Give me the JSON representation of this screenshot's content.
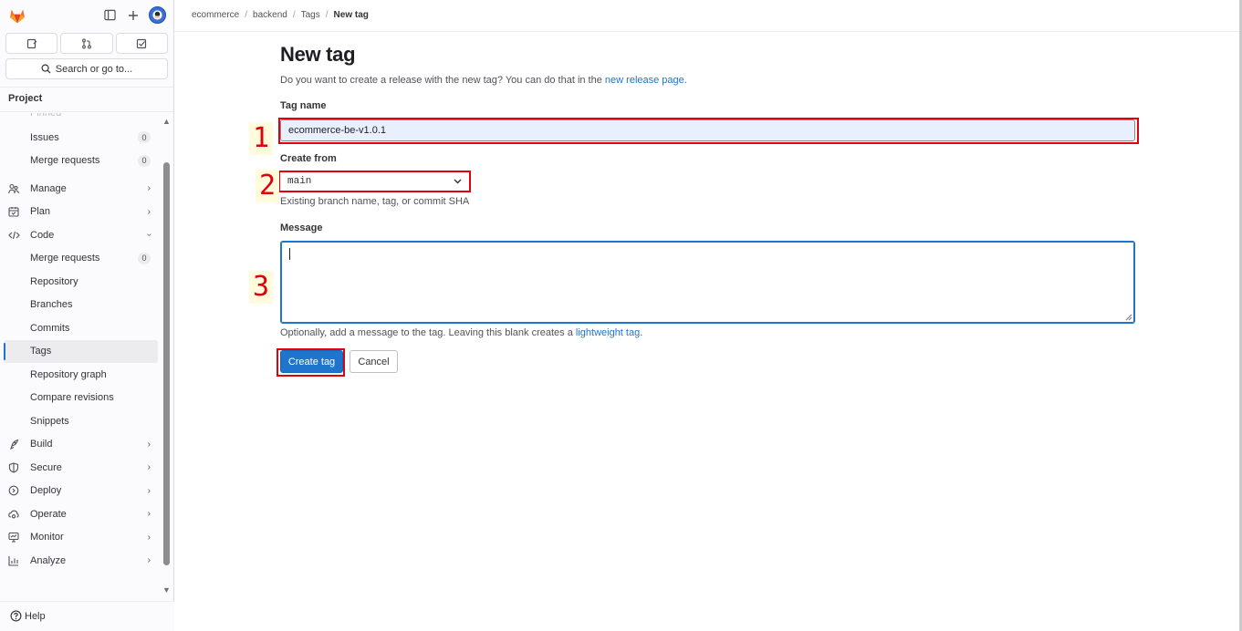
{
  "sidebar": {
    "search_label": "Search or go to...",
    "section_title": "Project",
    "faded_item": "Pinned",
    "items": [
      {
        "label": "Issues",
        "badge": "0"
      },
      {
        "label": "Merge requests",
        "badge": "0"
      },
      {
        "label": "Manage"
      },
      {
        "label": "Plan"
      },
      {
        "label": "Code"
      },
      {
        "label": "Merge requests",
        "badge": "0"
      },
      {
        "label": "Repository"
      },
      {
        "label": "Branches"
      },
      {
        "label": "Commits"
      },
      {
        "label": "Tags"
      },
      {
        "label": "Repository graph"
      },
      {
        "label": "Compare revisions"
      },
      {
        "label": "Snippets"
      },
      {
        "label": "Build"
      },
      {
        "label": "Secure"
      },
      {
        "label": "Deploy"
      },
      {
        "label": "Operate"
      },
      {
        "label": "Monitor"
      },
      {
        "label": "Analyze"
      }
    ],
    "help_label": "Help"
  },
  "breadcrumb": [
    "ecommerce",
    "backend",
    "Tags",
    "New tag"
  ],
  "page": {
    "title": "New tag",
    "intro_text": "Do you want to create a release with the new tag? You can do that in the",
    "intro_link": "new release page",
    "intro_end": ".",
    "tag_name_label": "Tag name",
    "tag_name_value": "ecommerce-be-v1.0.1",
    "create_from_label": "Create from",
    "create_from_value": "main",
    "create_from_hint": "Existing branch name, tag, or commit SHA",
    "message_label": "Message",
    "message_hint_text": "Optionally, add a message to the tag. Leaving this blank creates a",
    "message_hint_link": "lightweight tag",
    "message_hint_end": ".",
    "create_button": "Create tag",
    "cancel_button": "Cancel"
  },
  "annotations": [
    "1",
    "2",
    "3"
  ],
  "colors": {
    "accent": "#1f75cb",
    "annotation_red": "#e1000c",
    "annotation_bg": "#fffbdc"
  }
}
